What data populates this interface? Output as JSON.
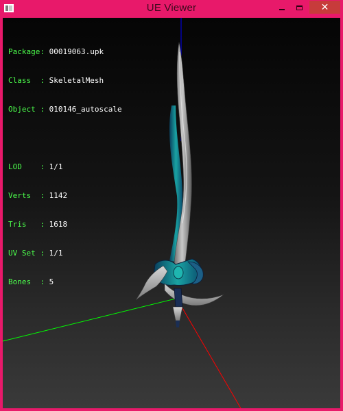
{
  "window": {
    "title": "UE Viewer",
    "icon": "app-icon",
    "controls": {
      "minimize_icon": "minimize-icon",
      "maximize_icon": "maximize-icon",
      "close_label": "✕"
    }
  },
  "info": {
    "package_label": "Package:",
    "package_value": "00019063.upk",
    "class_label": "Class  :",
    "class_value": "SkeletalMesh",
    "object_label": "Object :",
    "object_value": "010146_autoscale",
    "lod_label": "LOD    :",
    "lod_value": "1/1",
    "verts_label": "Verts  :",
    "verts_value": "1142",
    "tris_label": "Tris   :",
    "tris_value": "1618",
    "uvset_label": "UV Set :",
    "uvset_value": "1/1",
    "bones_label": "Bones  :",
    "bones_value": "5"
  },
  "scene": {
    "axis_x_color": "#ff0000",
    "axis_y_color": "#00ff00",
    "axis_z_color": "#0000ff",
    "mesh": "sword-mesh"
  },
  "colors": {
    "titlebar": "#e8196a",
    "close_button": "#c73b3b",
    "label_text": "#4cff4c",
    "value_text": "#ffffff"
  }
}
